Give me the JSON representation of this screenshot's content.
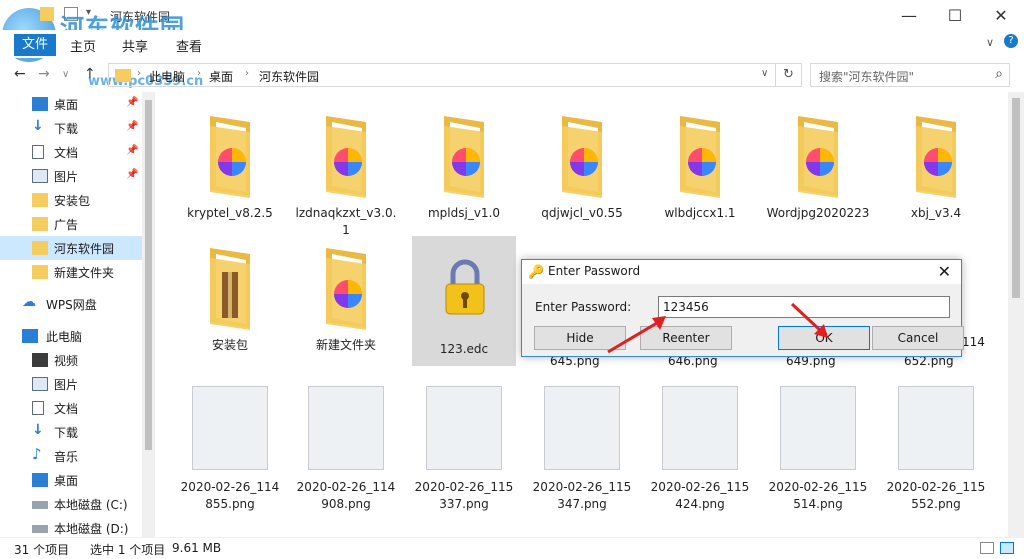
{
  "window": {
    "title": "河东软件园",
    "watermark": "河东软件园",
    "watermark_url": "www.pc0359.cn"
  },
  "ribbon": {
    "tabs": [
      "文件",
      "主页",
      "共享",
      "查看"
    ]
  },
  "address": {
    "parts": [
      "此电脑",
      "桌面",
      "河东软件园"
    ],
    "search_placeholder": "搜索\"河东软件园\""
  },
  "sidebar": {
    "items": [
      {
        "label": "桌面",
        "icon": "desktop-icon",
        "pinned": true
      },
      {
        "label": "下载",
        "icon": "download-icon",
        "pinned": true
      },
      {
        "label": "文档",
        "icon": "document-icon",
        "pinned": true
      },
      {
        "label": "图片",
        "icon": "picture-icon",
        "pinned": true
      },
      {
        "label": "安装包",
        "icon": "folder-icon",
        "pinned": false
      },
      {
        "label": "广告",
        "icon": "folder-icon",
        "pinned": false
      },
      {
        "label": "河东软件园",
        "icon": "folder-icon",
        "pinned": false,
        "selected": true
      },
      {
        "label": "新建文件夹",
        "icon": "folder-icon",
        "pinned": false
      },
      {
        "label": "WPS网盘",
        "icon": "cloud-icon",
        "pinned": false
      },
      {
        "label": "此电脑",
        "icon": "computer-icon",
        "pinned": false
      },
      {
        "label": "视频",
        "icon": "video-icon",
        "pinned": false
      },
      {
        "label": "图片",
        "icon": "picture-icon",
        "pinned": false
      },
      {
        "label": "文档",
        "icon": "document-icon",
        "pinned": false
      },
      {
        "label": "下载",
        "icon": "download-icon",
        "pinned": false
      },
      {
        "label": "音乐",
        "icon": "music-icon",
        "pinned": false
      },
      {
        "label": "桌面",
        "icon": "desktop-icon",
        "pinned": false
      },
      {
        "label": "本地磁盘 (C:)",
        "icon": "drive-icon",
        "pinned": false
      },
      {
        "label": "本地磁盘 (D:)",
        "icon": "drive-icon",
        "pinned": false
      }
    ]
  },
  "files": {
    "row1": [
      "kryptel_v8.2.5",
      "lzdnaqkzxt_v3.0.1",
      "mpldsj_v1.0",
      "qdjwjcl_v0.55",
      "wlbdjccx1.1",
      "Wordjpg2020223",
      "xbj_v3.4"
    ],
    "row2": [
      "安装包",
      "新建文件夹",
      "123.edc"
    ],
    "row2_hidden_suffixes": [
      "645.png",
      "646.png",
      "649.png",
      "652.png"
    ],
    "row3": [
      "2020-02-26_114855.png",
      "2020-02-26_114908.png",
      "2020-02-26_115337.png",
      "2020-02-26_115347.png",
      "2020-02-26_115424.png",
      "2020-02-26_115514.png",
      "2020-02-26_115552.png"
    ],
    "partial_label": "114"
  },
  "status": {
    "count": "31 个项目",
    "selected": "选中 1 个项目",
    "size": "9.61 MB"
  },
  "dialog": {
    "title": "Enter Password",
    "label": "Enter Password:",
    "value": "123456",
    "buttons": [
      "Hide",
      "Reenter",
      "OK",
      "Cancel"
    ]
  },
  "colors": {
    "accent": "#1979ca",
    "selection": "#cce8ff",
    "folder": "#f5cd5e",
    "arrow": "#e02020"
  }
}
